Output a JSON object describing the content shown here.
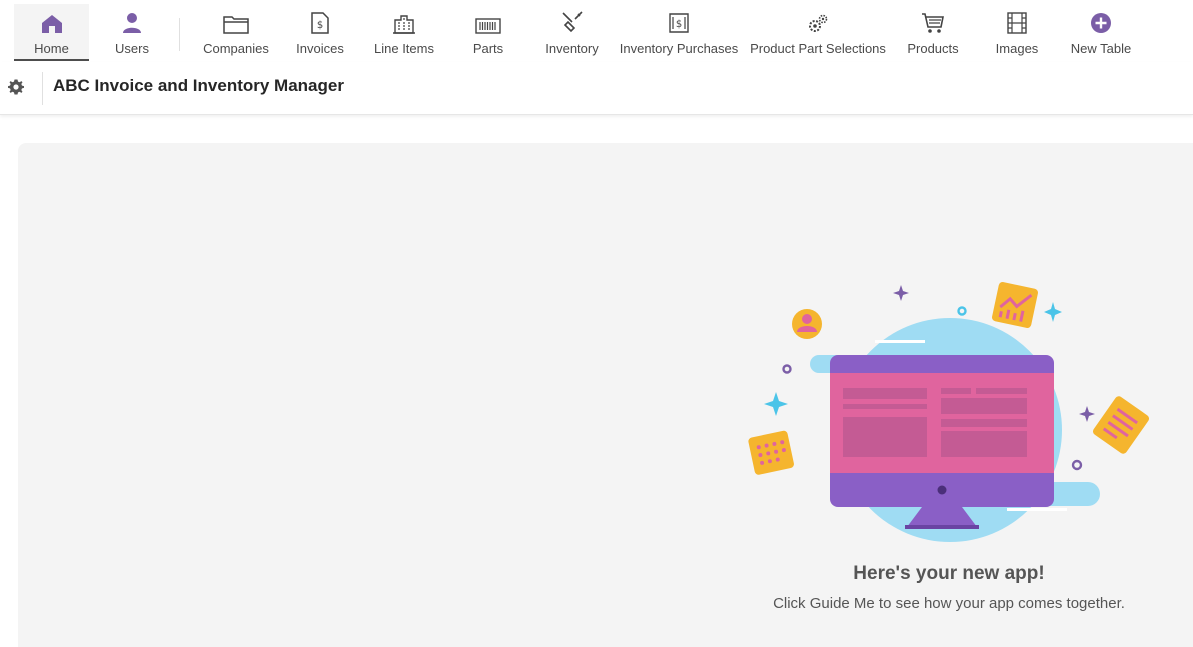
{
  "tabs": [
    {
      "label": "Home",
      "icon": "home-icon",
      "active": true
    },
    {
      "label": "Users",
      "icon": "user-icon"
    },
    {
      "label": "Companies",
      "icon": "folder-icon"
    },
    {
      "label": "Invoices",
      "icon": "invoice-icon"
    },
    {
      "label": "Line Items",
      "icon": "building-icon"
    },
    {
      "label": "Parts",
      "icon": "barcode-icon"
    },
    {
      "label": "Inventory",
      "icon": "tools-icon"
    },
    {
      "label": "Inventory Purchases",
      "icon": "receipt-icon"
    },
    {
      "label": "Product Part Selections",
      "icon": "gears-icon"
    },
    {
      "label": "Products",
      "icon": "cart-icon"
    },
    {
      "label": "Images",
      "icon": "film-icon"
    },
    {
      "label": "New Table",
      "icon": "plus-circle-icon"
    }
  ],
  "header": {
    "title": "ABC Invoice and Inventory Manager",
    "settings_icon": "gear-icon"
  },
  "empty_state": {
    "title": "Here's your new app!",
    "subtitle": "Click Guide Me to see how your app comes together."
  },
  "colors": {
    "accent": "#7b5ea7",
    "tab_active_bg": "#f4f4f4",
    "canvas_bg": "#f4f4f4"
  }
}
